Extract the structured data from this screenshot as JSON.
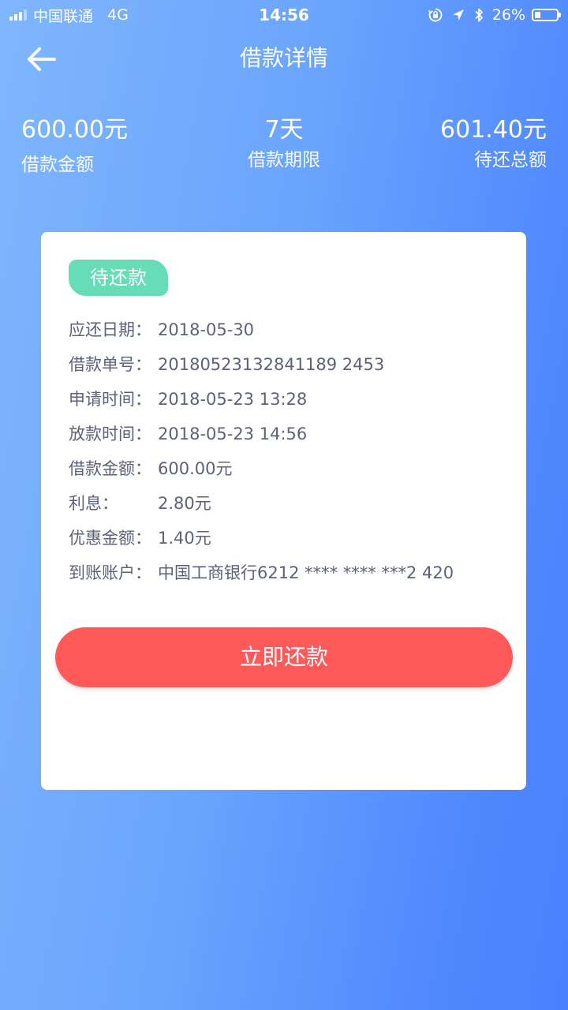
{
  "status_bar": {
    "carrier": "中国联通",
    "network": "4G",
    "time": "14:56",
    "battery_percent": "26%",
    "battery_level": 0.26
  },
  "header": {
    "title": "借款详情",
    "back_icon": "arrow-left-icon"
  },
  "summary": {
    "loan_amount": {
      "value": "600.00元",
      "label": "借款金额"
    },
    "loan_term": {
      "value": "7天",
      "label": "借款期限"
    },
    "total_due": {
      "value": "601.40元",
      "label": "待还总额"
    }
  },
  "card": {
    "status_badge": "待还款",
    "details": [
      {
        "label": "应还日期：",
        "value": "2018-05-30"
      },
      {
        "label": "借款单号：",
        "value": "20180523132841189 2453"
      },
      {
        "label": "申请时间：",
        "value": "2018-05-23 13:28"
      },
      {
        "label": "放款时间：",
        "value": "2018-05-23 14:56"
      },
      {
        "label": "借款金额：",
        "value": "600.00元"
      },
      {
        "label": "利息：",
        "value": "2.80元"
      },
      {
        "label": "优惠金额：",
        "value": "1.40元"
      },
      {
        "label": "到账账户：",
        "value": "中国工商银行6212 **** **** ***2 420"
      }
    ],
    "repay_button_label": "立即还款"
  },
  "colors": {
    "badge": "#66dcb7",
    "repay_button": "#ff5959",
    "detail_text": "#5c6277",
    "gradient_start": "#7fb6fd",
    "gradient_end": "#4a82fe"
  }
}
